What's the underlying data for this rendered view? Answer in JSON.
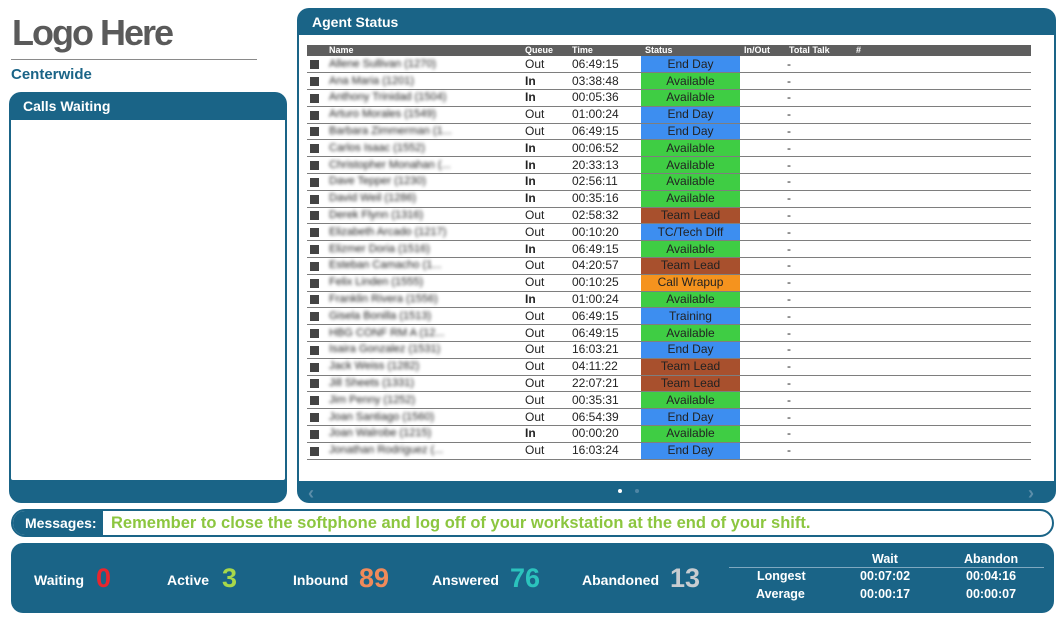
{
  "logo": {
    "text": "Logo Here"
  },
  "centerwide_label": "Centerwide",
  "calls_waiting": {
    "title": "Calls Waiting"
  },
  "agent_status": {
    "title": "Agent Status",
    "columns": {
      "name": "Name",
      "queue": "Queue",
      "time": "Time",
      "status": "Status",
      "inout": "In/Out",
      "total_talk": "Total Talk",
      "num": "#"
    },
    "rows": [
      {
        "name": "Allene Sullivan (1270)",
        "queue": "Out",
        "time": "06:49:15",
        "status": "End Day",
        "total_talk": "-"
      },
      {
        "name": "Ana Maria (1201)",
        "queue": "In",
        "time": "03:38:48",
        "status": "Available",
        "total_talk": "-"
      },
      {
        "name": "Anthony Trinidad (1504)",
        "queue": "In",
        "time": "00:05:36",
        "status": "Available",
        "total_talk": "-"
      },
      {
        "name": "Arturo Morales (1549)",
        "queue": "Out",
        "time": "01:00:24",
        "status": "End Day",
        "total_talk": "-"
      },
      {
        "name": "Barbara Zimmerman (1...",
        "queue": "Out",
        "time": "06:49:15",
        "status": "End Day",
        "total_talk": "-"
      },
      {
        "name": "Carlos Isaac (1552)",
        "queue": "In",
        "time": "00:06:52",
        "status": "Available",
        "total_talk": "-"
      },
      {
        "name": "Christopher Monahan (...",
        "queue": "In",
        "time": "20:33:13",
        "status": "Available",
        "total_talk": "-"
      },
      {
        "name": "Dave Tepper (1230)",
        "queue": "In",
        "time": "02:56:11",
        "status": "Available",
        "total_talk": "-"
      },
      {
        "name": "David Weil (1286)",
        "queue": "In",
        "time": "00:35:16",
        "status": "Available",
        "total_talk": "-"
      },
      {
        "name": "Derek Flynn (1316)",
        "queue": "Out",
        "time": "02:58:32",
        "status": "Team Lead",
        "total_talk": "-"
      },
      {
        "name": "Elizabeth Arcado (1217)",
        "queue": "Out",
        "time": "00:10:20",
        "status": "TC/Tech Diff",
        "total_talk": "-"
      },
      {
        "name": "Elizmer Doria (1516)",
        "queue": "In",
        "time": "06:49:15",
        "status": "Available",
        "total_talk": "-"
      },
      {
        "name": "Esteban Camacho (1...",
        "queue": "Out",
        "time": "04:20:57",
        "status": "Team Lead",
        "total_talk": "-"
      },
      {
        "name": "Felix Linden (1555)",
        "queue": "Out",
        "time": "00:10:25",
        "status": "Call Wrapup",
        "total_talk": "-"
      },
      {
        "name": "Franklin Rivera (1556)",
        "queue": "In",
        "time": "01:00:24",
        "status": "Available",
        "total_talk": "-"
      },
      {
        "name": "Gisela Bonilla (1513)",
        "queue": "Out",
        "time": "06:49:15",
        "status": "Training",
        "total_talk": "-"
      },
      {
        "name": "HBG CONF RM A (12...",
        "queue": "Out",
        "time": "06:49:15",
        "status": "Available",
        "total_talk": "-"
      },
      {
        "name": "Isaira Gonzalez (1531)",
        "queue": "Out",
        "time": "16:03:21",
        "status": "End Day",
        "total_talk": "-"
      },
      {
        "name": "Jack Weiss (1282)",
        "queue": "Out",
        "time": "04:11:22",
        "status": "Team Lead",
        "total_talk": "-"
      },
      {
        "name": "Jill Sheets (1331)",
        "queue": "Out",
        "time": "22:07:21",
        "status": "Team Lead",
        "total_talk": "-"
      },
      {
        "name": "Jim Penny (1252)",
        "queue": "Out",
        "time": "00:35:31",
        "status": "Available",
        "total_talk": "-"
      },
      {
        "name": "Joan Santiago (1560)",
        "queue": "Out",
        "time": "06:54:39",
        "status": "End Day",
        "total_talk": "-"
      },
      {
        "name": "Joan Walrobe (1215)",
        "queue": "In",
        "time": "00:00:20",
        "status": "Available",
        "total_talk": "-"
      },
      {
        "name": "Jonathan Rodriguez (...",
        "queue": "Out",
        "time": "16:03:24",
        "status": "End Day",
        "total_talk": "-"
      }
    ]
  },
  "status_colors": {
    "End Day": "#3d8ef0",
    "Available": "#3fcd44",
    "Team Lead": "#a8502d",
    "TC/Tech Diff": "#3d8ef0",
    "Call Wrapup": "#f5931e",
    "Training": "#3d8ef0"
  },
  "messages": {
    "label": "Messages:",
    "text": "Remember to close the softphone and log off of your workstation at the end of your shift."
  },
  "stats": {
    "waiting": {
      "label": "Waiting",
      "value": "0",
      "color": "#e8262e"
    },
    "active": {
      "label": "Active",
      "value": "3",
      "color": "#a8d84a"
    },
    "inbound": {
      "label": "Inbound",
      "value": "89",
      "color": "#f08a5a"
    },
    "answered": {
      "label": "Answered",
      "value": "76",
      "color": "#2bc3bd"
    },
    "abandoned": {
      "label": "Abandoned",
      "value": "13",
      "color": "#c8ccd0"
    },
    "wait_header": "Wait",
    "abandon_header": "Abandon",
    "longest": {
      "label": "Longest",
      "wait": "00:07:02",
      "abandon": "00:04:16"
    },
    "average": {
      "label": "Average",
      "wait": "00:00:17",
      "abandon": "00:00:07"
    }
  },
  "icons": {
    "prev": "chevron-left-icon",
    "next": "chevron-right-icon"
  }
}
